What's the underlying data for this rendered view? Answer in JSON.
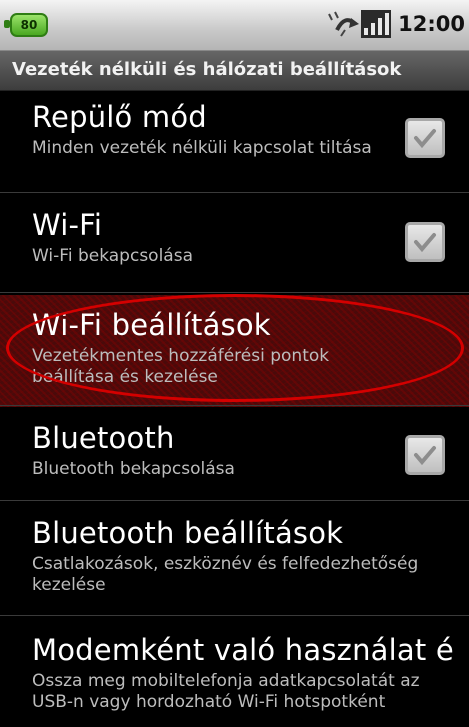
{
  "status_bar": {
    "battery_level": "80",
    "time": "12:00",
    "icons": [
      "battery-icon",
      "sync-icon",
      "signal-icon"
    ]
  },
  "section_header": "Vezeték nélküli és hálózati beállítások",
  "settings": [
    {
      "title": "Repülő mód",
      "summary": "Minden vezeték nélküli kapcsolat tiltása",
      "checked": true
    },
    {
      "title": "Wi-Fi",
      "summary": "Wi-Fi bekapcsolása",
      "checked": true
    },
    {
      "title": "Wi-Fi beállítások",
      "summary": "Vezetékmentes hozzáférési pontok beállítása és kezelése"
    },
    {
      "title": "Bluetooth",
      "summary": "Bluetooth bekapcsolása",
      "checked": true
    },
    {
      "title": "Bluetooth beállítások",
      "summary": "Csatlakozások, eszköznév és felfedezhetőség kezelése"
    },
    {
      "title": "Modemként való használat é",
      "summary": "Ossza meg mobiltelefonja adatkapcsolatát az USB-n vagy hordozható Wi-Fi hotspotként"
    }
  ],
  "colors": {
    "highlight_ring": "#d40000",
    "battery_green": "#4aa821",
    "header_gray": "#4a4a4a"
  }
}
